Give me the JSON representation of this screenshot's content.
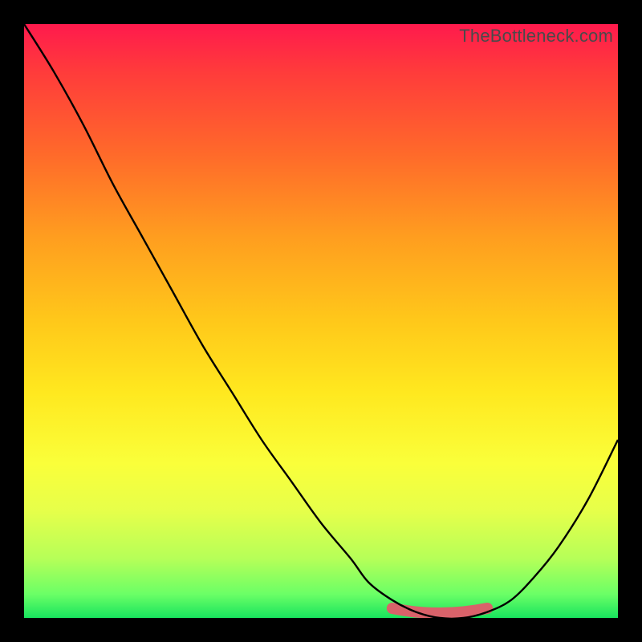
{
  "watermark": {
    "text": "TheBottleneck.com"
  },
  "colors": {
    "curve": "#000000",
    "marker": "#d9626a",
    "gradient_stops": [
      "#ff1a4d",
      "#ff3b3b",
      "#ff6a2a",
      "#ff9e1f",
      "#ffc81a",
      "#ffe81f",
      "#faff3a",
      "#e6ff4a",
      "#b6ff58",
      "#6bff66",
      "#18e45e"
    ]
  },
  "chart_data": {
    "type": "line",
    "title": "",
    "xlabel": "",
    "ylabel": "",
    "xlim": [
      0,
      100
    ],
    "ylim": [
      0,
      100
    ],
    "grid": false,
    "series": [
      {
        "name": "bottleneck-curve",
        "x": [
          0,
          5,
          10,
          15,
          20,
          25,
          30,
          35,
          40,
          45,
          50,
          55,
          58,
          62,
          66,
          70,
          74,
          78,
          82,
          86,
          90,
          95,
          100
        ],
        "y": [
          100,
          92,
          83,
          73,
          64,
          55,
          46,
          38,
          30,
          23,
          16,
          10,
          6,
          3,
          1,
          0,
          0,
          1,
          3,
          7,
          12,
          20,
          30
        ]
      }
    ],
    "annotations": [
      {
        "name": "optimal-band",
        "x_start": 62,
        "x_end": 78,
        "y": 0
      }
    ]
  }
}
